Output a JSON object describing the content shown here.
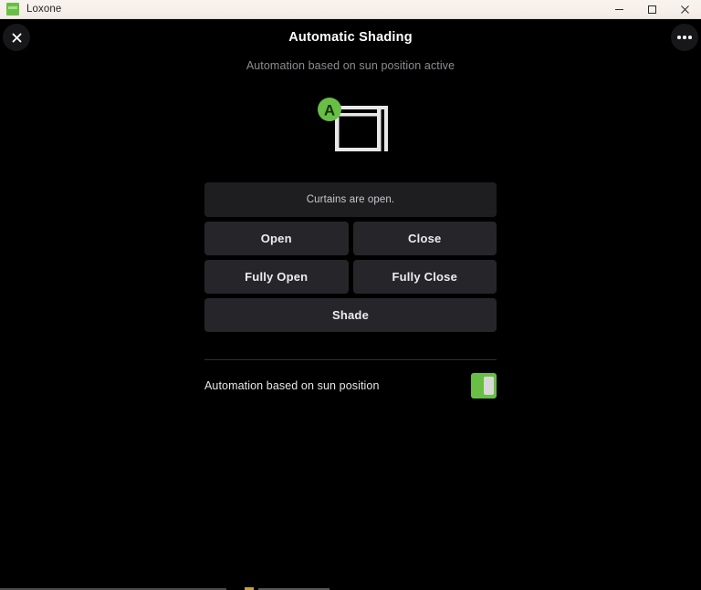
{
  "window": {
    "app_name": "Loxone",
    "app_icon": "loxone-logo-icon",
    "controls": {
      "minimize": "minimize-icon",
      "maximize": "maximize-icon",
      "close": "close-icon"
    }
  },
  "header": {
    "close_icon": "close-x-icon",
    "menu_icon": "more-options-icon",
    "title": "Automatic Shading",
    "subtitle": "Automation based on sun position active"
  },
  "device": {
    "icon_name": "curtain-open-icon",
    "badge_label": "A",
    "badge_color": "#69BE46"
  },
  "status": {
    "text": "Curtains are open."
  },
  "controls": {
    "row1": [
      {
        "label": "Open",
        "name": "open-button"
      },
      {
        "label": "Close",
        "name": "close-button"
      }
    ],
    "row2": [
      {
        "label": "Fully Open",
        "name": "fully-open-button"
      },
      {
        "label": "Fully Close",
        "name": "fully-close-button"
      }
    ],
    "shade": {
      "label": "Shade",
      "name": "shade-button"
    }
  },
  "automation": {
    "label": "Automation based on sun position",
    "toggle_state": "on",
    "toggle_on_color": "#69BE46",
    "toggle_knob_color": "#D8D8D8"
  },
  "theme": {
    "background": "#000000",
    "panel": "#1E1E20",
    "button": "#26262A",
    "accent": "#69BE46",
    "title_bar": "#F6EFEA"
  }
}
